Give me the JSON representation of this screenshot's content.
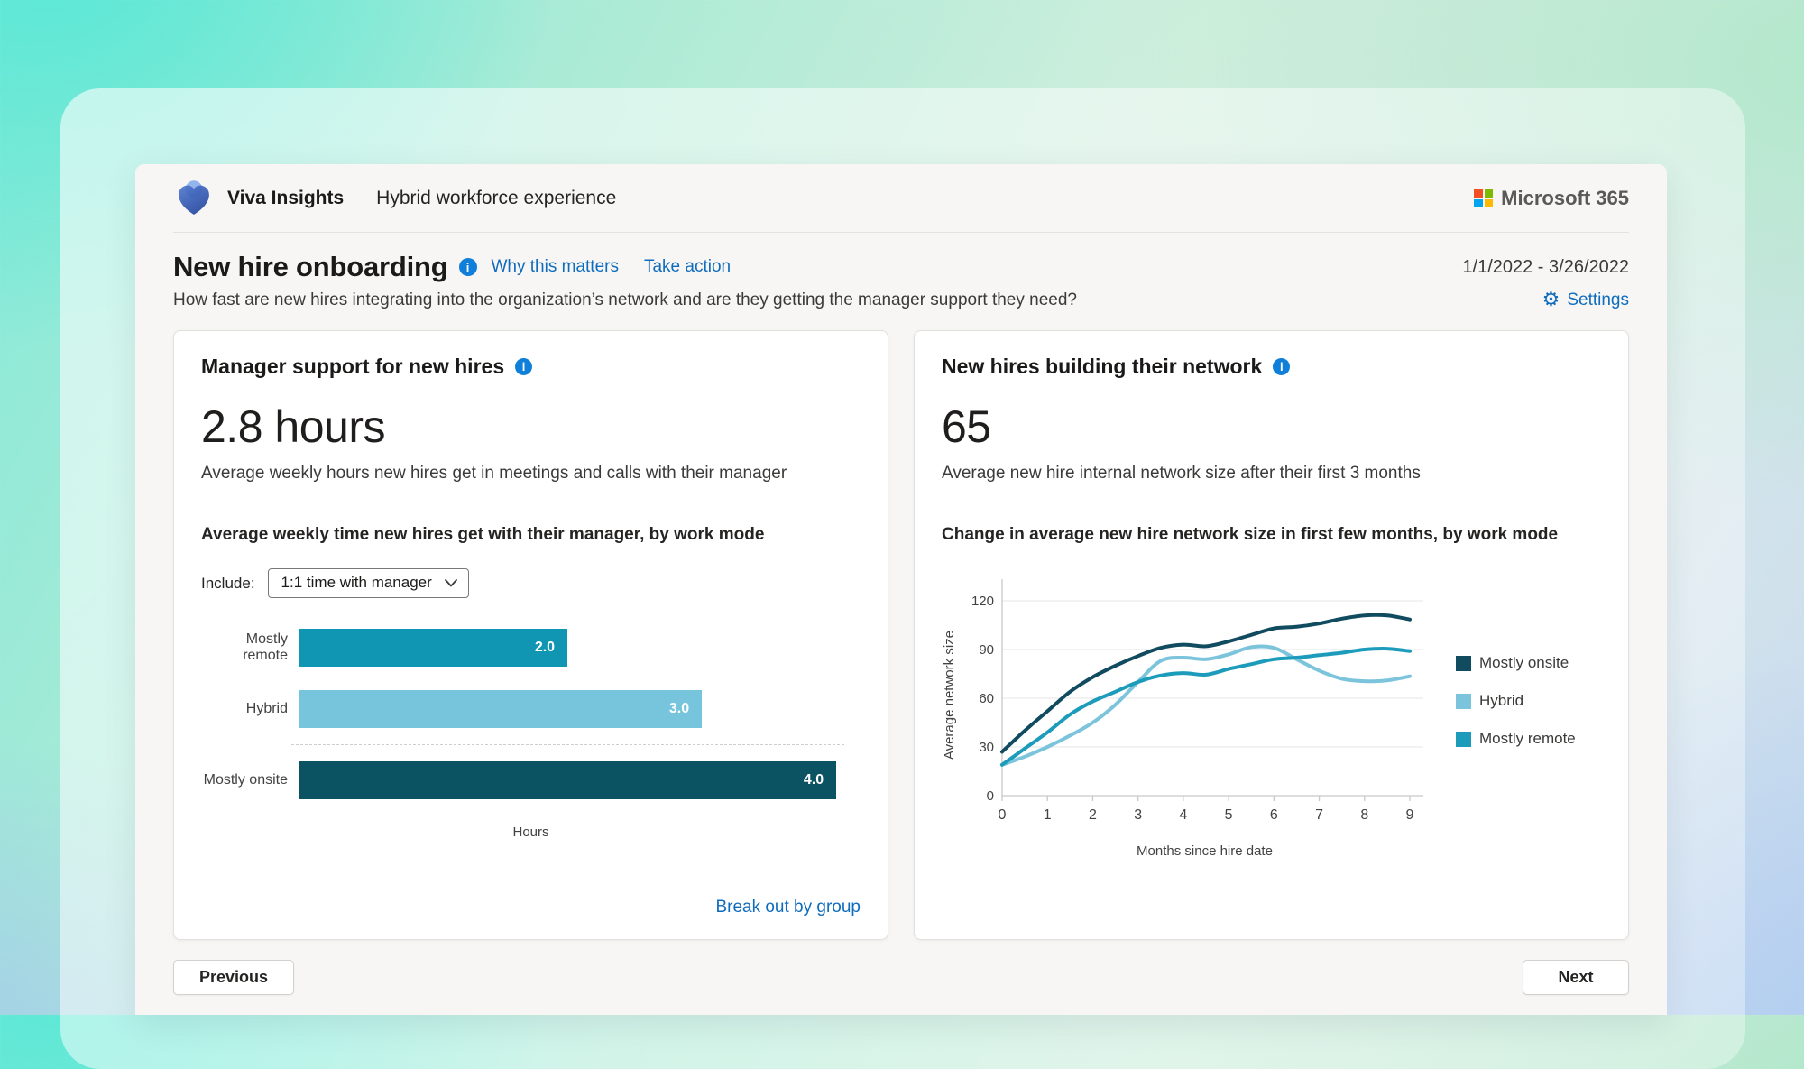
{
  "header": {
    "app_name": "Viva Insights",
    "page_title": "Hybrid workforce experience",
    "brand": "Microsoft 365"
  },
  "section": {
    "title": "New hire onboarding",
    "why_link": "Why this matters",
    "action_link": "Take action",
    "date_range": "1/1/2022 - 3/26/2022",
    "description": "How fast are new hires integrating into the organization’s network and are they getting the manager support they need?",
    "settings_link": "Settings"
  },
  "cards": {
    "manager_support": {
      "title": "Manager support for new hires",
      "metric": "2.8 hours",
      "metric_caption": "Average weekly hours new hires get in meetings and calls with their manager",
      "chart_title": "Average weekly time new hires get with their manager, by work mode",
      "include_label": "Include:",
      "include_value": "1:1 time with manager",
      "footer_link": "Break out by group"
    },
    "network": {
      "title": "New hires building their network",
      "metric": "65",
      "metric_caption": "Average new hire internal network size after their first 3 months",
      "chart_title": "Change in average new hire network size in first few months, by work mode"
    }
  },
  "footer": {
    "previous": "Previous",
    "next": "Next"
  },
  "colors": {
    "link_blue": "#0f6cbd",
    "info_icon_blue": "#0f7fd9",
    "gridline": "#e7e6e5",
    "axis": "#c9c8c7"
  },
  "icons": {
    "viva_logo": "viva-heart-logo",
    "microsoft_logo": "microsoft-four-squares",
    "info": "info-circle-icon",
    "gear": "⚙",
    "dropdown_chevron": "chevron-down"
  },
  "chart_data": [
    {
      "type": "bar",
      "orientation": "horizontal",
      "title": "Average weekly time new hires get with their manager, by work mode",
      "categories": [
        "Mostly remote",
        "Hybrid",
        "Mostly onsite"
      ],
      "values": [
        2.0,
        3.0,
        4.0
      ],
      "value_labels": [
        "2.0",
        "3.0",
        "4.0"
      ],
      "colors": [
        "#1095b2",
        "#76c5dd",
        "#0b5363"
      ],
      "xlabel": "Hours",
      "xlim": [
        0,
        4.18
      ],
      "grid": false
    },
    {
      "type": "line",
      "title": "Change in average new hire network size in first few months, by work mode",
      "xlabel": "Months since hire date",
      "ylabel": "Average network size",
      "xlim": [
        0,
        9
      ],
      "ylim": [
        0,
        120
      ],
      "xticks": [
        0,
        1,
        2,
        3,
        4,
        5,
        6,
        7,
        8,
        9
      ],
      "yticks": [
        0,
        30,
        60,
        90,
        120
      ],
      "grid": "horizontal",
      "legend_position": "right",
      "x": [
        0,
        0.5,
        1,
        1.5,
        2,
        2.5,
        3,
        3.5,
        4,
        4.5,
        5,
        5.5,
        6,
        6.5,
        7,
        7.5,
        8,
        8.5,
        9
      ],
      "series": [
        {
          "name": "Mostly onsite",
          "color": "#114b5f",
          "y": [
            27,
            40,
            52,
            64,
            73,
            80,
            86,
            91,
            93,
            92,
            95,
            99,
            103,
            104,
            106,
            109,
            111,
            111,
            108.5
          ]
        },
        {
          "name": "Hybrid",
          "color": "#7cc4dc",
          "y": [
            19,
            24,
            30,
            37,
            45,
            56,
            70,
            83,
            85,
            84,
            87,
            91.5,
            91,
            84,
            77,
            72,
            70.5,
            71,
            73.5
          ]
        },
        {
          "name": "Mostly remote",
          "color": "#1c9cba",
          "y": [
            19,
            29,
            39,
            50,
            58,
            64,
            70,
            74,
            75.5,
            74.5,
            78,
            81,
            84,
            85,
            86.5,
            88,
            90,
            90.5,
            89
          ]
        }
      ]
    }
  ]
}
